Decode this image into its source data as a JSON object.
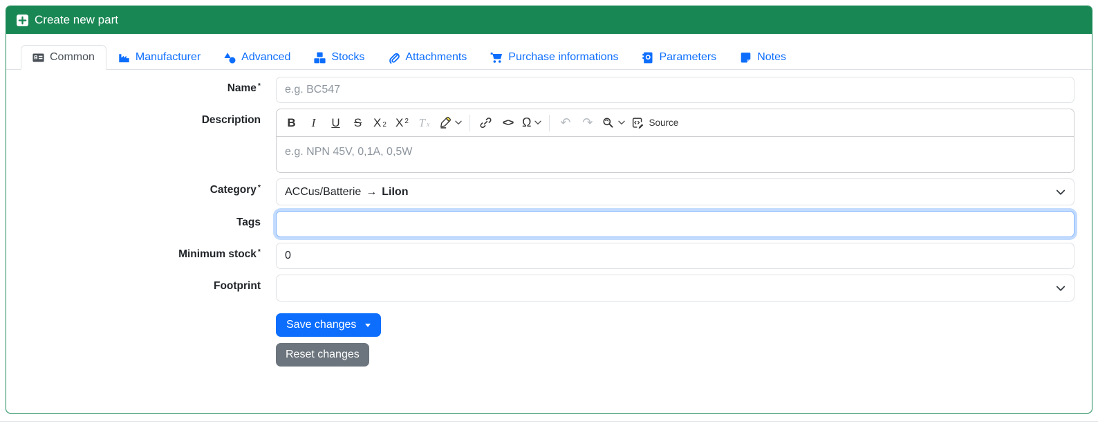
{
  "header": {
    "title": "Create new part"
  },
  "tabs": [
    {
      "label": "Common",
      "icon": "address-card-icon",
      "active": true
    },
    {
      "label": "Manufacturer",
      "icon": "factory-icon",
      "active": false
    },
    {
      "label": "Advanced",
      "icon": "shapes-icon",
      "active": false
    },
    {
      "label": "Stocks",
      "icon": "boxes-stacked-icon",
      "active": false
    },
    {
      "label": "Attachments",
      "icon": "paperclip-icon",
      "active": false
    },
    {
      "label": "Purchase informations",
      "icon": "shopping-cart-icon",
      "active": false
    },
    {
      "label": "Parameters",
      "icon": "address-book-icon",
      "active": false
    },
    {
      "label": "Notes",
      "icon": "sticky-note-icon",
      "active": false
    }
  ],
  "form": {
    "name": {
      "label": "Name",
      "required": "*",
      "placeholder": "e.g. BC547",
      "value": ""
    },
    "description": {
      "label": "Description",
      "placeholder": "e.g. NPN 45V, 0,1A, 0,5W",
      "value": ""
    },
    "category": {
      "label": "Category",
      "required": "*",
      "value_path": "ACCus/Batterie",
      "value_arrow": "→",
      "value_leaf": "LiIon"
    },
    "tags": {
      "label": "Tags",
      "value": "",
      "focused": true
    },
    "minimum_stock": {
      "label": "Minimum stock",
      "required": "*",
      "value": "0"
    },
    "footprint": {
      "label": "Footprint",
      "value": ""
    },
    "buttons": {
      "save": "Save changes",
      "reset": "Reset changes"
    }
  },
  "editor": {
    "bold": "B",
    "italic": "I",
    "underline": "U",
    "strikethrough": "S",
    "sub_main": "X",
    "sub_small": "2",
    "sup_main": "X",
    "sup_small": "2",
    "removefmt_main": "T",
    "removefmt_small": "x",
    "code": "<>",
    "omega": "Ω",
    "undo": "↶",
    "redo": "↷",
    "source": "Source",
    "icon_names": [
      "bold",
      "italic",
      "underline",
      "strikethrough",
      "subscript",
      "superscript",
      "remove-format",
      "highlight-marker",
      "link",
      "code",
      "special-characters",
      "undo",
      "redo",
      "find-and-replace",
      "source"
    ]
  },
  "icons": {
    "header_icon": "plus-square-icon",
    "select_chevron": "chevron-down-icon",
    "save_caret": "caret-down-icon",
    "marker_tip_color": "#f2e24b"
  },
  "colors": {
    "success_green": "#198754",
    "primary_blue": "#0d6efd",
    "secondary_gray": "#6c757d",
    "border_gray": "#dee2e6",
    "active_tab_text": "#495057",
    "focus_ring": "#86b7fe",
    "placeholder": "#8d959e"
  }
}
